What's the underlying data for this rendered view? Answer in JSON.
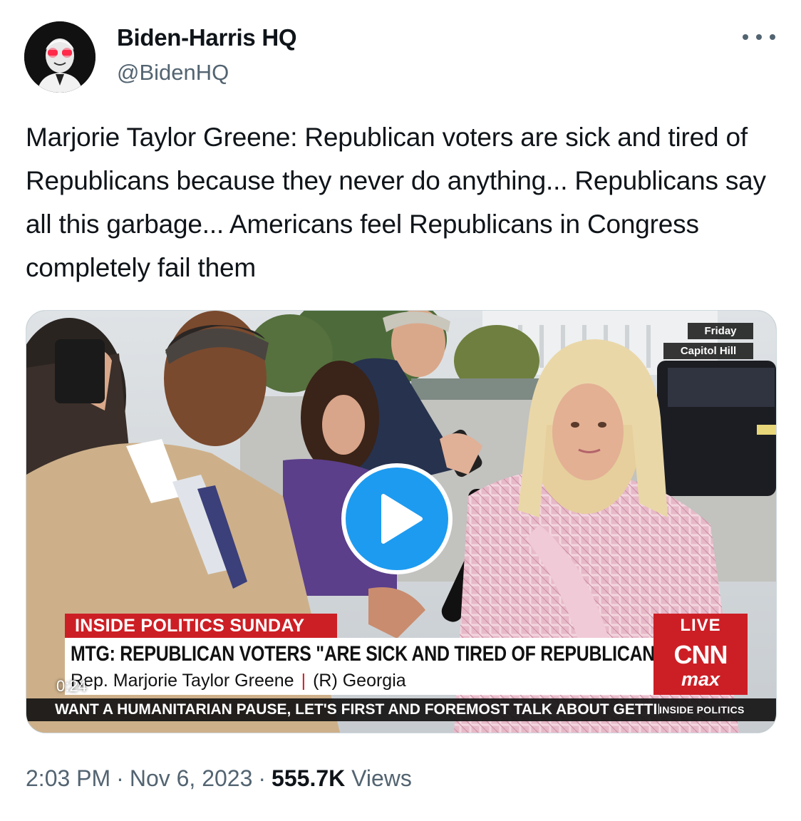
{
  "author": {
    "display_name": "Biden-Harris HQ",
    "handle": "@BidenHQ"
  },
  "tweet": {
    "text": "Marjorie Taylor Greene: Republican voters are sick and tired of Republicans because they never do anything... Republicans say all this garbage... Americans feel Republicans in Congress completely fail them"
  },
  "video": {
    "duration": "0:24",
    "corner_tags": {
      "day": "Friday",
      "location": "Capitol Hill"
    },
    "lower_third": {
      "show": "INSIDE POLITICS SUNDAY",
      "live": "LIVE",
      "headline": "MTG: REPUBLICAN VOTERS \"ARE SICK AND TIRED OF REPUBLICANS\"",
      "name": "Rep. Marjorie Taylor Greene",
      "separator": "|",
      "affiliation": "(R) Georgia",
      "network": "CNN",
      "network_sub": "max"
    },
    "ticker": {
      "text": "WANT A HUMANITARIAN PAUSE, LET'S FIRST AND FOREMOST TALK ABOUT GETTII",
      "brand": "INSIDE POLITICS"
    }
  },
  "meta": {
    "time": "2:03 PM",
    "date": "Nov 6, 2023",
    "dot": "·",
    "views_count": "555.7K",
    "views_label": "Views"
  },
  "colors": {
    "accent": "#1d9bf0",
    "secondary_text": "#536471",
    "cnn_red": "#cc1f25"
  },
  "icons": {
    "more": "more-horizontal-icon",
    "play": "play-icon"
  }
}
